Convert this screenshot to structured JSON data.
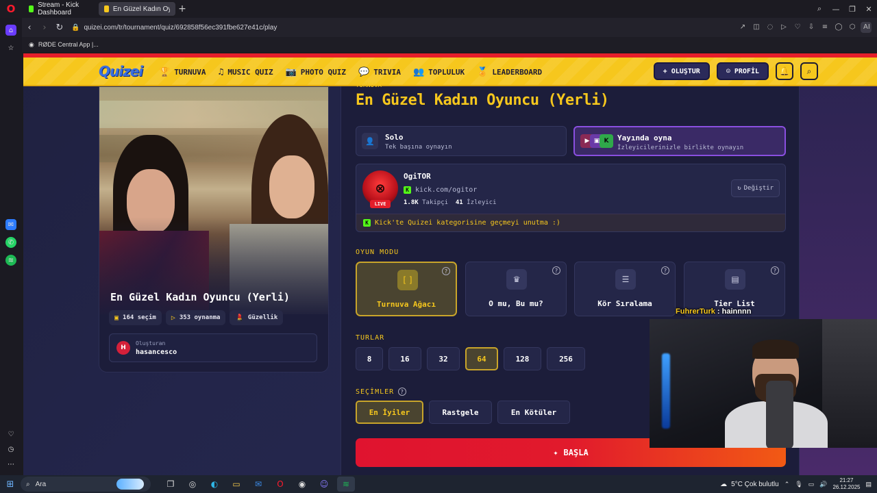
{
  "browser": {
    "tabs": [
      {
        "label": "Stream - Kick Dashboard",
        "favicon_color": "#53fc18",
        "active": false
      },
      {
        "label": "En Güzel Kadın Oyuncu (...",
        "favicon_color": "#f6c71d",
        "active": true
      }
    ],
    "url": "quizei.com/tr/tournament/quiz/692858f56ec391fbe627e41c/play",
    "ai_label": "AI",
    "bookmark": "RØDE Central App |..."
  },
  "nav": {
    "logo": "Quizei",
    "links": [
      {
        "icon": "trophy-icon",
        "glyph": "🏆",
        "label": "TURNUVA"
      },
      {
        "icon": "music-icon",
        "glyph": "♫",
        "label": "MUSIC QUIZ"
      },
      {
        "icon": "camera-icon",
        "glyph": "📷",
        "label": "PHOTO QUIZ"
      },
      {
        "icon": "chat-icon",
        "glyph": "💬",
        "label": "TRIVIA"
      },
      {
        "icon": "users-icon",
        "glyph": "👥",
        "label": "TOPLULUK"
      },
      {
        "icon": "award-icon",
        "glyph": "🏅",
        "label": "LEADERBOARD"
      }
    ],
    "create_label": "OLUŞTUR",
    "profile_label": "PROFİL"
  },
  "quiz": {
    "title": "En Güzel Kadın Oyuncu (Yerli)",
    "choices": "164 seçim",
    "plays": "353 oynanma",
    "category": "Güzellik",
    "creator_label": "Oluşturan",
    "creator_initial": "H",
    "creator_name": "hasancesco"
  },
  "panel": {
    "breadcrumb": "TURNUVA",
    "title": "En Güzel Kadın Oyuncu (Yerli)",
    "solo_title": "Solo",
    "solo_sub": "Tek başına oynayın",
    "live_title": "Yayında oyna",
    "live_sub": "İzleyicilerinizle birlikte oynayın",
    "streamer_name": "OgiTOR",
    "streamer_url": "kick.com/ogitor",
    "followers": "1.8K",
    "followers_label": "Takipçi",
    "viewers": "41",
    "viewers_label": "İzleyici",
    "live_badge": "LIVE",
    "change_label": "Değiştir",
    "kick_tip": "Kick'te Quizei kategorisine geçmeyi unutma :)",
    "mode_label": "OYUN MODU",
    "modes": [
      {
        "label": "Turnuva Ağacı",
        "icon": "bracket-icon",
        "glyph": "[ ]"
      },
      {
        "label": "O mu, Bu mu?",
        "icon": "crown-icon",
        "glyph": "♛"
      },
      {
        "label": "Kör Sıralama",
        "icon": "list-icon",
        "glyph": "☰"
      },
      {
        "label": "Tier List",
        "icon": "table-icon",
        "glyph": "▤"
      }
    ],
    "rounds_label": "TURLAR",
    "rounds": [
      "8",
      "16",
      "32",
      "64",
      "128",
      "256"
    ],
    "selected_round": "64",
    "picks_label": "SEÇİMLER",
    "picks": [
      "En İyiler",
      "Rastgele",
      "En Kötüler"
    ],
    "selected_pick": "En İyiler",
    "start_label": "BAŞLA"
  },
  "stream_overlay": {
    "chat_user": "FuhrerTurk",
    "chat_message": "hainnnn"
  },
  "taskbar": {
    "search_placeholder": "Ara",
    "weather": "5°C  Çok bulutlu",
    "time": "21:27",
    "date": "26.12.2025"
  }
}
